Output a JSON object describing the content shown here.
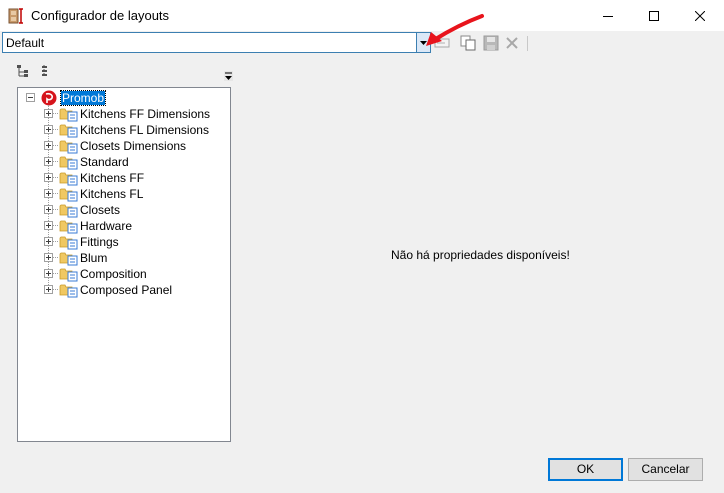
{
  "window": {
    "title": "Configurador de layouts",
    "app_icon": "layout-configurator-icon",
    "controls": [
      "minimize-icon",
      "maximize-icon",
      "close-icon"
    ]
  },
  "toolbar": {
    "layout_select_value": "Default",
    "icons": [
      "rename-icon",
      "copy-icon",
      "save-icon",
      "delete-icon"
    ]
  },
  "tree": {
    "root": {
      "label": "Promob",
      "expanded": true,
      "selected": true,
      "icon": "promob-logo-icon"
    },
    "items": [
      {
        "label": "Kitchens FF Dimensions"
      },
      {
        "label": "Kitchens FL Dimensions"
      },
      {
        "label": "Closets Dimensions"
      },
      {
        "label": "Standard"
      },
      {
        "label": "Kitchens FF"
      },
      {
        "label": "Kitchens FL"
      },
      {
        "label": "Closets"
      },
      {
        "label": "Hardware"
      },
      {
        "label": "Fittings"
      },
      {
        "label": "Blum"
      },
      {
        "label": "Composition"
      },
      {
        "label": "Composed Panel"
      }
    ]
  },
  "properties": {
    "empty_message": "Não há propriedades disponíveis!"
  },
  "buttons": {
    "ok": "OK",
    "cancel": "Cancelar"
  },
  "annotation": {
    "arrow_color": "#e8141c"
  },
  "colors": {
    "selection": "#0078d7",
    "border_accent": "#3c7fb1"
  }
}
